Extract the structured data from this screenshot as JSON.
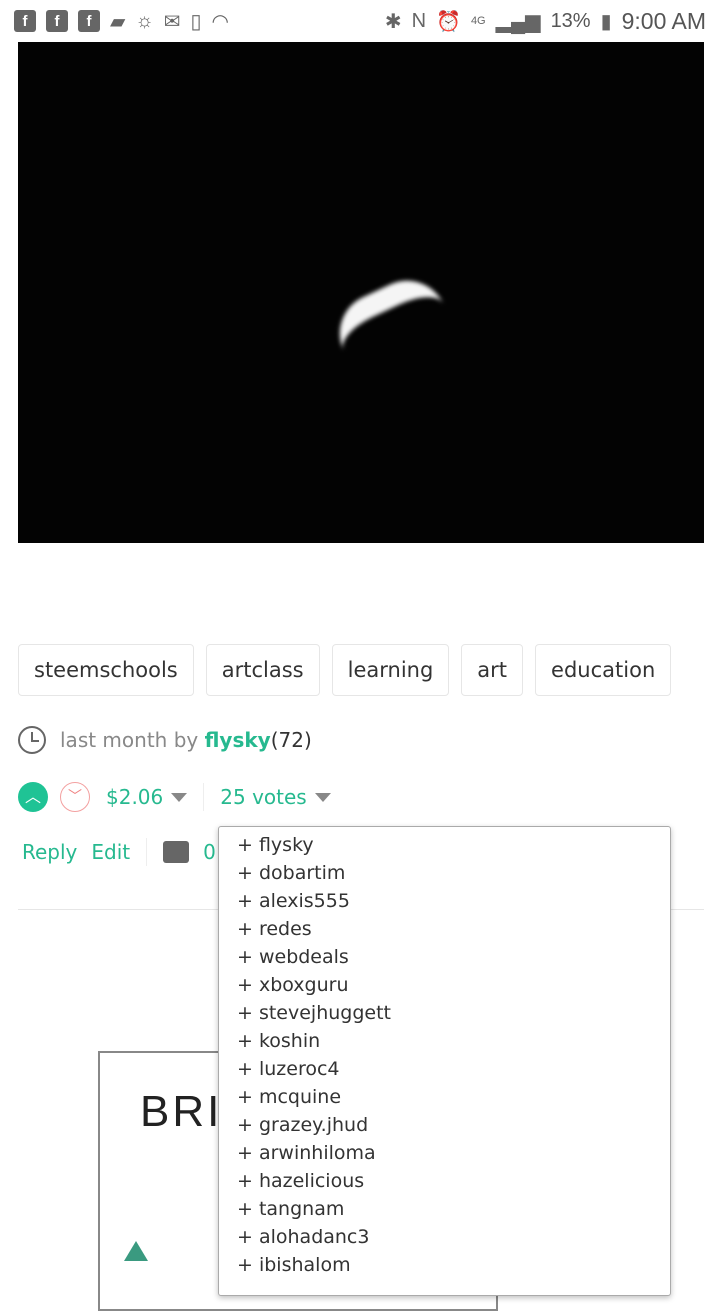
{
  "status_bar": {
    "battery": "13%",
    "time": "9:00 AM",
    "left_icons": [
      "facebook-icon",
      "facebook-icon",
      "facebook-icon",
      "message-icon",
      "weather-icon",
      "gmail-icon",
      "screen-clock-icon",
      "wifi-question-icon"
    ],
    "right_icons": [
      "bluetooth-icon",
      "nfc-icon",
      "alarm-icon",
      "4g-lte-icon",
      "signal-icon",
      "battery-icon"
    ]
  },
  "tags": [
    "steemschools",
    "artclass",
    "learning",
    "art",
    "education"
  ],
  "post_meta": {
    "time": "last month by",
    "author": "flysky",
    "reputation": "(72)"
  },
  "voting": {
    "payout": "$2.06",
    "votes": "25 votes"
  },
  "actions": {
    "reply": "Reply",
    "edit": "Edit",
    "comments": "0"
  },
  "voters": [
    "+ flysky",
    "+ dobartim",
    "+ alexis555",
    "+ redes",
    "+ webdeals",
    "+ xboxguru",
    "+ stevejhuggett",
    "+ koshin",
    "+ luzeroc4",
    "+ mcquine",
    "+ grazey.jhud",
    "+ arwinhiloma",
    "+ hazelicious",
    "+ tangnam",
    "+ alohadanc3",
    "+ ibishalom"
  ],
  "card": {
    "title": "BRI"
  },
  "colors": {
    "accent": "#26b98f",
    "upvote": "#1fc395"
  }
}
